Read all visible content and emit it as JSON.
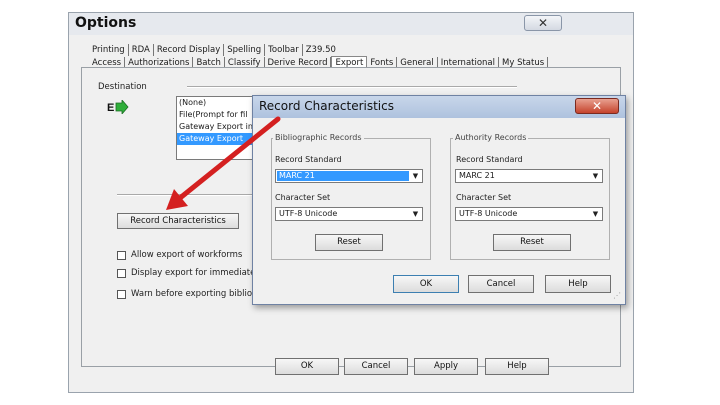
{
  "options": {
    "title": "Options",
    "close_symbol": "✕",
    "tabs_row1": [
      "Printing",
      "RDA",
      "Record Display",
      "Spelling",
      "Toolbar",
      "Z39.50"
    ],
    "tabs_row2": [
      "Access",
      "Authorizations",
      "Batch",
      "Classify",
      "Derive Record",
      "Export",
      "Fonts",
      "General",
      "International",
      "My Status"
    ],
    "active_tab": "Export",
    "destination_label": "Destination",
    "destination_items": [
      "(None)",
      "File(Prompt for fil",
      "Gateway Export in",
      "Gateway Export"
    ],
    "selected_destination_index": 3,
    "record_characteristics_button": "Record Characteristics",
    "checkboxes": [
      "Allow export of workforms",
      "Display export for immediate exp",
      "Warn before exporting bibliographic"
    ],
    "buttons": {
      "ok": "OK",
      "cancel": "Cancel",
      "apply": "Apply",
      "help": "Help"
    }
  },
  "dialog": {
    "title": "Record Characteristics",
    "close_symbol": "✕",
    "bib": {
      "group_label": "Bibliographic Records",
      "standard_label": "Record Standard",
      "standard_value": "MARC 21",
      "charset_label": "Character Set",
      "charset_value": "UTF-8 Unicode",
      "reset": "Reset"
    },
    "auth": {
      "group_label": "Authority Records",
      "standard_label": "Record Standard",
      "standard_value": "MARC 21",
      "charset_label": "Character Set",
      "charset_value": "UTF-8 Unicode",
      "reset": "Reset"
    },
    "buttons": {
      "ok": "OK",
      "cancel": "Cancel",
      "help": "Help"
    }
  },
  "annotation_color": "#d42020"
}
